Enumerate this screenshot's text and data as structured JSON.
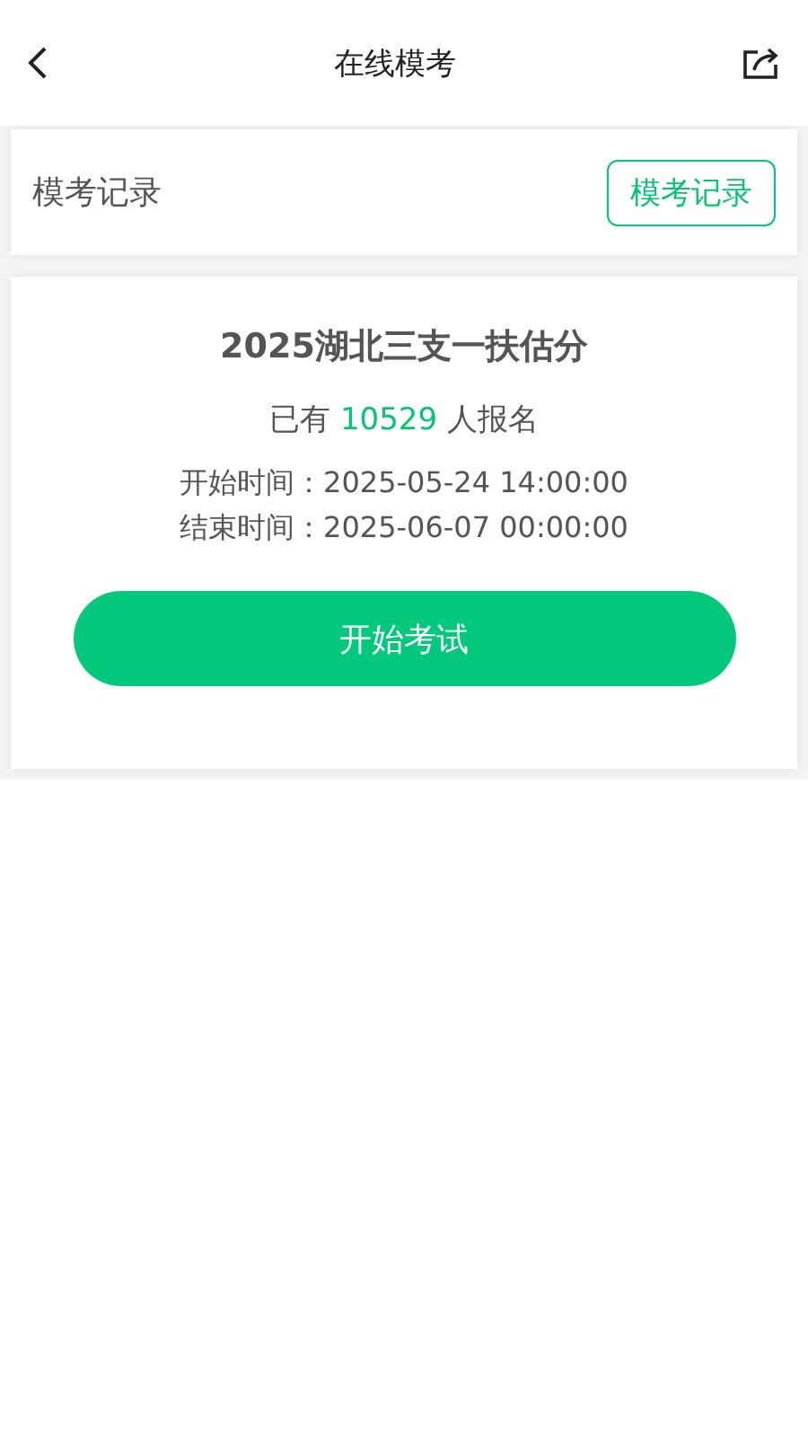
{
  "nav": {
    "title": "在线模考"
  },
  "records": {
    "label": "模考记录",
    "button": "模考记录"
  },
  "exam": {
    "title": "2025湖北三支一扶估分",
    "signup": {
      "prefix": "已有",
      "count": "10529",
      "suffix": "人报名"
    },
    "times": [
      {
        "label": "开始时间：",
        "value": "2025-05-24 14:00:00"
      },
      {
        "label": "结束时间：",
        "value": "2025-06-07 00:00:00"
      }
    ],
    "start_button": "开始考试"
  }
}
